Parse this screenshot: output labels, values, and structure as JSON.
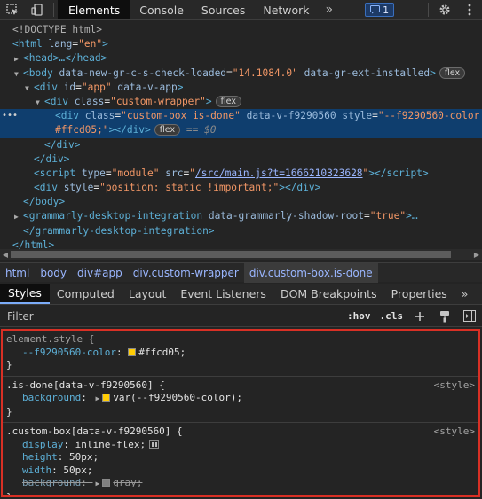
{
  "toolbar": {
    "tabs": [
      "Elements",
      "Console",
      "Sources",
      "Network"
    ],
    "more": "»",
    "issues_count": "1"
  },
  "tree": {
    "doctype": "<!DOCTYPE html>",
    "html_open_tag": "html",
    "html_lang_attr": "lang",
    "html_lang_val": "\"en\"",
    "head": "<head>…</head>",
    "body_tag": "body",
    "body_attr1": "data-new-gr-c-s-check-loaded",
    "body_val1": "\"14.1084.0\"",
    "body_attr2": "data-gr-ext-installed",
    "app_attr": "id",
    "app_val": "\"app\"",
    "app_attr2": "data-v-app",
    "wrapper_attr": "class",
    "wrapper_val": "\"custom-wrapper\"",
    "box_attr": "class",
    "box_val": "\"custom-box is-done\"",
    "box_attr2": "data-v-f9290560",
    "box_attr3": "style",
    "box_val3a": "\"--f9290560-color:",
    "box_val3b": "#ffcd05;\"",
    "dollar0": "== $0",
    "div_close": "</div>",
    "body_close": "</body>",
    "script_attr1": "type",
    "script_val1": "\"module\"",
    "script_attr2": "src",
    "script_src": "/src/main.js?t=1666210323628",
    "div2_attr": "style",
    "div2_val": "\"position: static !important;\"",
    "gdi_tag": "grammarly-desktop-integration",
    "gdi_attr": "data-grammarly-shadow-root",
    "gdi_val": "\"true\"",
    "gdi_close": "</grammarly-desktop-integration>",
    "html_close": "</html>",
    "flex_badge": "flex"
  },
  "breadcrumbs": [
    "html",
    "body",
    "div#app",
    "div.custom-wrapper",
    "div.custom-box.is-done"
  ],
  "subtabs": [
    "Styles",
    "Computed",
    "Layout",
    "Event Listeners",
    "DOM Breakpoints",
    "Properties",
    "»"
  ],
  "filter": {
    "placeholder": "Filter",
    "hov": ":hov",
    "cls": ".cls"
  },
  "styles": {
    "rules": [
      {
        "selector": "element.style {",
        "source": "",
        "decls": [
          {
            "prop": "--f9290560-color",
            "value": "#ffcd05",
            "swatch": "#ffcd05"
          }
        ]
      },
      {
        "selector": ".is-done[data-v-f9290560] {",
        "source": "<style>",
        "decls": [
          {
            "prop": "background",
            "value": "var(--f9290560-color)",
            "swatch": "#ffcd05"
          }
        ]
      },
      {
        "selector": ".custom-box[data-v-f9290560] {",
        "source": "<style>",
        "decls": [
          {
            "prop": "display",
            "value": "inline-flex"
          },
          {
            "prop": "height",
            "value": "50px"
          },
          {
            "prop": "width",
            "value": "50px"
          },
          {
            "prop": "background",
            "value": "gray",
            "swatch": "#808080",
            "struck": true
          }
        ]
      }
    ],
    "close_brace": "}"
  },
  "colors": {
    "accent": "#7cacf8",
    "highlight_border": "#d93025",
    "selected_row": "#0f3e6e"
  }
}
